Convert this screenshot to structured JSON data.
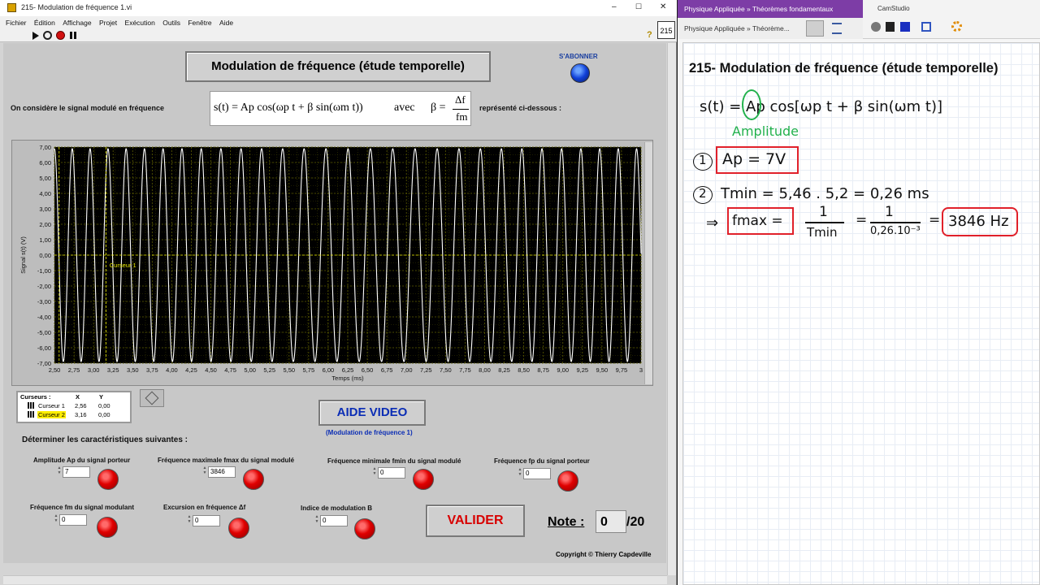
{
  "labview": {
    "window_title": "215- Modulation de fréquence 1.vi",
    "win_min": "–",
    "win_max": "☐",
    "win_close": "✕",
    "menu": [
      "Fichier",
      "Édition",
      "Affichage",
      "Projet",
      "Exécution",
      "Outils",
      "Fenêtre",
      "Aide"
    ],
    "vi_badge": "215",
    "help_icon_glyph": "?",
    "title": "Modulation de fréquence (étude temporelle)",
    "subscribe_label": "S'ABONNER",
    "intro_text": "On considère le signal modulé en fréquence",
    "formula_main": "s(t) = Ap cos(ωp t + β sin(ωm t))",
    "formula_avec": "avec",
    "formula_beta": "β =",
    "formula_num": "Δf",
    "formula_den": "fm",
    "formula_suffix": "représenté ci-dessous :",
    "graph": {
      "ylabel": "Signal s(t) (V)",
      "xlabel": "Temps (ms)",
      "cursor_label": "Curseur 1",
      "y_ticks": [
        "7,00",
        "6,00",
        "5,00",
        "4,00",
        "3,00",
        "2,00",
        "1,00",
        "0,00",
        "-1,00",
        "-2,00",
        "-3,00",
        "-4,00",
        "-5,00",
        "-6,00",
        "-7,00"
      ],
      "x_ticks": [
        "2,50",
        "2,75",
        "3,00",
        "3,25",
        "3,50",
        "3,75",
        "4,00",
        "4,25",
        "4,50",
        "4,75",
        "5,00",
        "5,25",
        "5,50",
        "5,75",
        "6,00",
        "6,25",
        "6,50",
        "6,75",
        "7,00",
        "7,25",
        "7,50",
        "7,75",
        "8,00",
        "8,25",
        "8,50",
        "8,75",
        "9,00",
        "9,25",
        "9,50",
        "9,75",
        "3"
      ]
    },
    "cursor_table": {
      "headers": [
        "Curseurs :",
        "X",
        "Y"
      ],
      "rows": [
        {
          "name": "Curseur 1",
          "x": "2,56",
          "y": "0,00"
        },
        {
          "name": "Curseur 2",
          "x": "3,16",
          "y": "0,00"
        }
      ]
    },
    "aide_video": "AIDE VIDEO",
    "aide_sub": "(Modulation de fréquence 1)",
    "determine": "Déterminer les caractéristiques suivantes :",
    "fields": [
      {
        "label": "Amplitude Ap du signal porteur",
        "value": "7"
      },
      {
        "label": "Fréquence maximale fmax du signal modulé",
        "value": "3846"
      },
      {
        "label": "Fréquence minimale fmin du signal modulé",
        "value": "0"
      },
      {
        "label": "Fréquence fp du signal porteur",
        "value": "0"
      },
      {
        "label": "Fréquence  fm du signal modulant",
        "value": "0"
      },
      {
        "label": "Excursion en fréquence Δf",
        "value": "0"
      },
      {
        "label": "Indice de modulation B",
        "value": "0"
      }
    ],
    "valider": "VALIDER",
    "note_label": "Note :",
    "note_value": "0",
    "note_total": "/20",
    "copyright": "Copyright © Thierry Capdeville"
  },
  "onenote": {
    "title": "Physique Appliquée » Théorèmes fondamentaux",
    "tab": "Physique Appliquée » Théorème...",
    "camstudio": "CamStudio",
    "heading": "215- Modulation de fréquence (étude temporelle)",
    "hw_formula": "s(t) = Ap cos[ωp t + β sin(ωm t)]",
    "hw_amplitude": "Amplitude",
    "hw_1_num": "1",
    "hw_1": "Ap = 7V",
    "hw_2_num": "2",
    "hw_2": "Tmin = 5,46 . 5,2 = 0,26 ms",
    "hw_fmax_arrow": "⇒",
    "hw_fmax": "fmax =",
    "hw_frac1_num": "1",
    "hw_frac1_den": "Tmin",
    "hw_eq": "=",
    "hw_frac2_num": "1",
    "hw_frac2_den": "0,26.10⁻³",
    "hw_eq2": "=",
    "hw_result": "3846 Hz"
  },
  "colors": {
    "onenote_purple": "#7d3da6",
    "led_red": "#e00000",
    "graph_bg": "#000000",
    "graph_grid": "#5c5c00",
    "signal": "#ffffff",
    "ink_red": "#e0202a",
    "ink_green": "#22b14c",
    "aide_blue": "#0b2db5"
  }
}
